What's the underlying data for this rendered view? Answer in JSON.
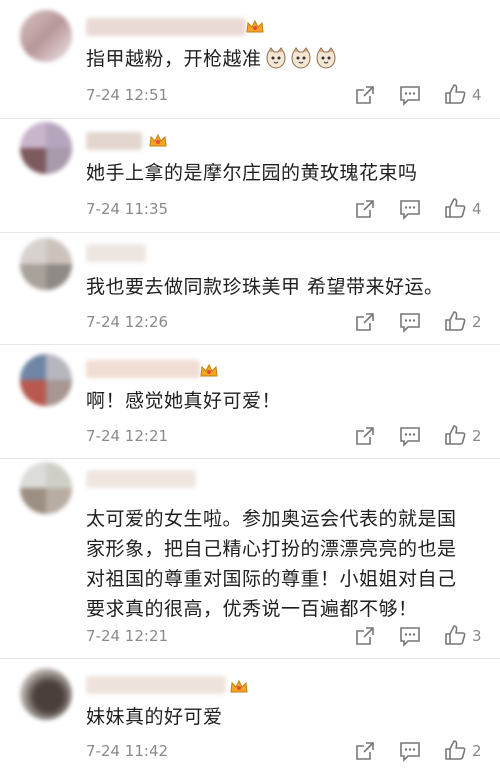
{
  "comments": [
    {
      "text": "指甲越粉，开枪越准",
      "time": "7-24 12:51",
      "likes": "4",
      "emojis": [
        "cat-face-emoji",
        "cat-face-emoji",
        "cat-face-emoji"
      ]
    },
    {
      "text": "她手上拿的是摩尔庄园的黄玫瑰花束吗",
      "time": "7-24 11:35",
      "likes": "4"
    },
    {
      "text": "我也要去做同款珍珠美甲 希望带来好运。",
      "time": "7-24 12:26",
      "likes": "2"
    },
    {
      "text": "啊！感觉她真好可爱！",
      "time": "7-24 12:21",
      "likes": "2"
    },
    {
      "text_lines": [
        "太可爱的女生啦。参加奥运会代表的就是国",
        "家形象，把自己精心打扮的漂漂亮亮的也是",
        "对祖国的尊重对国际的尊重！小姐姐对自己",
        "要求真的很高，优秀说一百遍都不够！"
      ],
      "time": "7-24 12:21",
      "likes": "3"
    },
    {
      "text": "妹妹真的好可爱",
      "time": "7-24 11:42",
      "likes": "2"
    }
  ],
  "colors": {
    "text": "#1f1f1f",
    "meta": "#8a8a8a",
    "icon": "#777777",
    "crown": "#f5a623"
  }
}
